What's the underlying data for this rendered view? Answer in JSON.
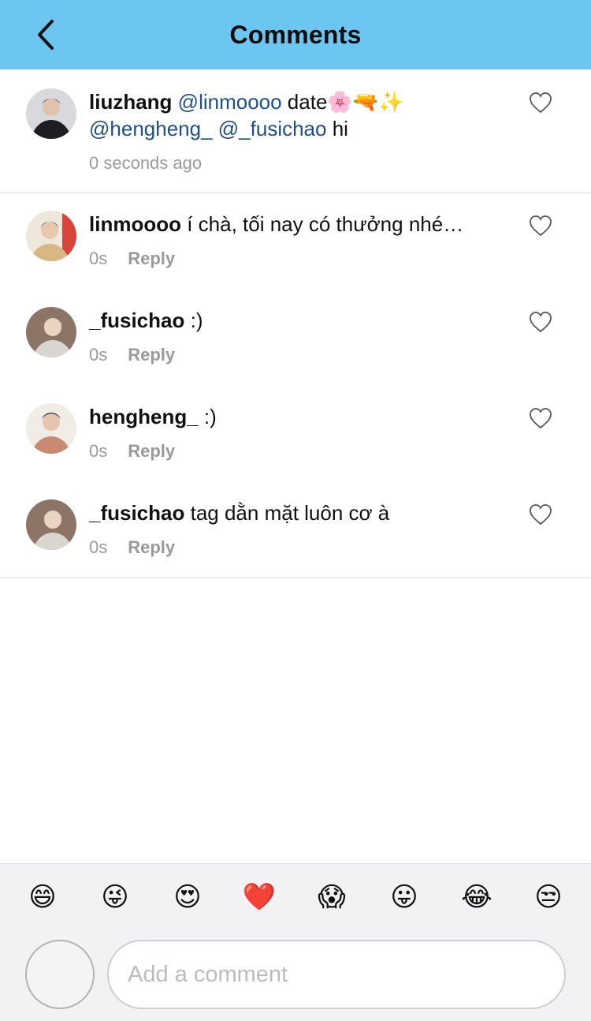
{
  "header": {
    "title": "Comments",
    "back_icon": "chevron-left-icon"
  },
  "comments": [
    {
      "username": "liuzhang",
      "text_parts": [
        "@linmoooo",
        " date🌸🔫✨",
        "@hengheng_",
        " ",
        "@_fusichao",
        " hi"
      ],
      "time": "0 seconds ago",
      "reply_label": "",
      "avatar_color": "#2a2a2e"
    },
    {
      "username": "linmoooo",
      "text": " í chà, tối nay có thưởng nhé…",
      "time": "0s",
      "reply_label": "Reply",
      "avatar_color": "#c8a981"
    },
    {
      "username": "_fusichao",
      "text": " :)",
      "time": "0s",
      "reply_label": "Reply",
      "avatar_color": "#a18b7e"
    },
    {
      "username": "hengheng_",
      "text": " :)",
      "time": "0s",
      "reply_label": "Reply",
      "avatar_color": "#c99a86"
    },
    {
      "username": "_fusichao",
      "text": " tag dằn mặt luôn cơ à",
      "time": "0s",
      "reply_label": "Reply",
      "avatar_color": "#a18b7e"
    }
  ],
  "emoji_bar": [
    "😄",
    "😜",
    "😍",
    "❤️",
    "😱",
    "😛",
    "😂",
    "😒"
  ],
  "composer": {
    "placeholder": "Add a comment"
  },
  "colors": {
    "header_bg": "#6dc6f1",
    "mention": "#1f4f85",
    "meta": "#9a9a9a"
  }
}
